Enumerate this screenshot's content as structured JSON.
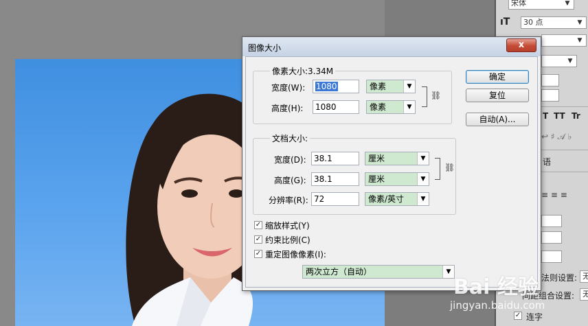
{
  "right_panel": {
    "font_family": "宋体",
    "font_size": "30 点",
    "t_icon": "T",
    "styles": [
      "T",
      "TT",
      "Tr",
      "T"
    ],
    "lang": "语",
    "setting_label_1": "法则设置:",
    "setting_label_2": "间距组合设置:",
    "setting_value": "无",
    "lianzi": "连字"
  },
  "dialog": {
    "title": "图像大小",
    "close_label": "x",
    "pixel_group": {
      "legend": "像素大小:3.34M",
      "width_label": "宽度(W):",
      "width_value": "1080",
      "width_unit": "像素",
      "height_label": "高度(H):",
      "height_value": "1080",
      "height_unit": "像素"
    },
    "doc_group": {
      "legend": "文档大小:",
      "width_label": "宽度(D):",
      "width_value": "38.1",
      "width_unit": "厘米",
      "height_label": "高度(G):",
      "height_value": "38.1",
      "height_unit": "厘米",
      "res_label": "分辨率(R):",
      "res_value": "72",
      "res_unit": "像素/英寸"
    },
    "checkboxes": [
      {
        "label": "缩放样式(Y)",
        "checked": true
      },
      {
        "label": "约束比例(C)",
        "checked": true
      },
      {
        "label": "重定图像像素(I):",
        "checked": true
      }
    ],
    "resample_method": "两次立方（自动）",
    "buttons": {
      "ok": "确定",
      "reset": "复位",
      "auto": "自动(A)..."
    }
  },
  "watermark": {
    "logo": "Bai 经验",
    "url": "jingyan.baidu.com"
  },
  "colors": {
    "combo_bg": "#cfe9d0",
    "photo_bg": "#4a98e8",
    "close_btn": "#c44b35"
  }
}
